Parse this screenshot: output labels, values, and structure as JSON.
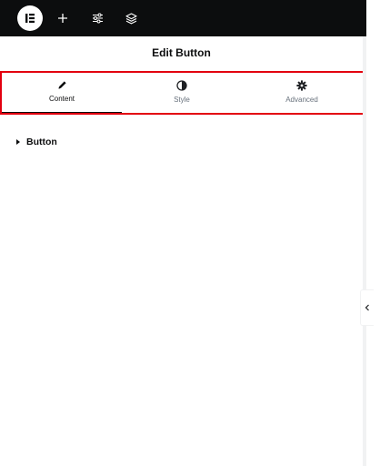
{
  "topbar": {
    "logo_icon": "elementor-logo-icon",
    "buttons": [
      {
        "name": "add-element-button",
        "icon": "plus-icon"
      },
      {
        "name": "site-settings-button",
        "icon": "sliders-icon"
      },
      {
        "name": "structure-button",
        "icon": "layers-icon"
      }
    ]
  },
  "panel": {
    "title": "Edit Button",
    "tabs": [
      {
        "label": "Content",
        "icon": "pencil-icon",
        "active": true
      },
      {
        "label": "Style",
        "icon": "half-circle-icon",
        "active": false
      },
      {
        "label": "Advanced",
        "icon": "gear-icon",
        "active": false
      }
    ],
    "sections": [
      {
        "label": "Button",
        "expanded": false
      }
    ]
  },
  "collapse": {
    "icon": "chevron-left-icon"
  },
  "colors": {
    "topbar": "#0c0d0e",
    "highlight": "#e3000f",
    "text": "#0c0d0e",
    "muted": "#69727d"
  }
}
